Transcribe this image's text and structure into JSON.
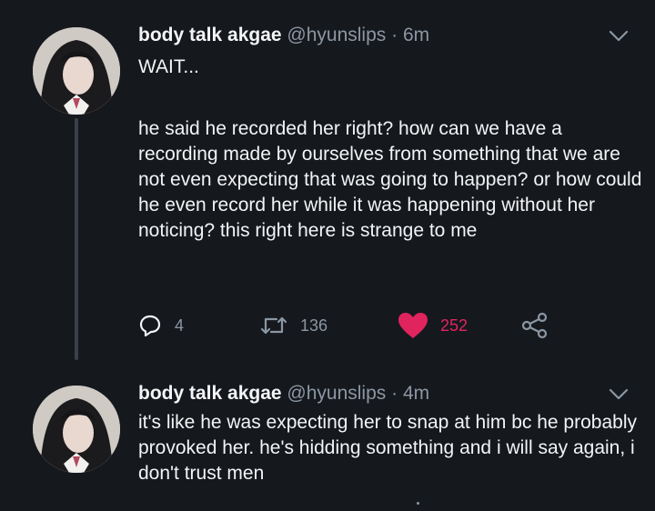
{
  "tweets": [
    {
      "display_name": "body talk akgae",
      "handle": "@hyunslips",
      "separator": "·",
      "time": "6m",
      "text_lines": [
        "WAIT...",
        "he said he recorded her right? how can we have a recording made by ourselves from something that we are not even expecting that was going to happen? or how could he even record her while it was happening without her noticing? this right here is strange to me"
      ],
      "reply_count": "4",
      "retweet_count": "136",
      "like_count": "252",
      "liked": true
    },
    {
      "display_name": "body talk akgae",
      "handle": "@hyunslips",
      "separator": "·",
      "time": "4m",
      "text_lines": [
        "it's like he was expecting her to snap at him bc he probably provoked her. he's hidding something and i will say again, i don't trust men"
      ]
    }
  ],
  "icons": {
    "reply": "reply-icon",
    "retweet": "retweet-icon",
    "like": "heart-icon",
    "share": "share-icon",
    "menu": "chevron-down-icon"
  },
  "colors": {
    "background": "#15181d",
    "text": "#f3f4f5",
    "secondary": "#8b97a3",
    "like": "#e0245e"
  }
}
